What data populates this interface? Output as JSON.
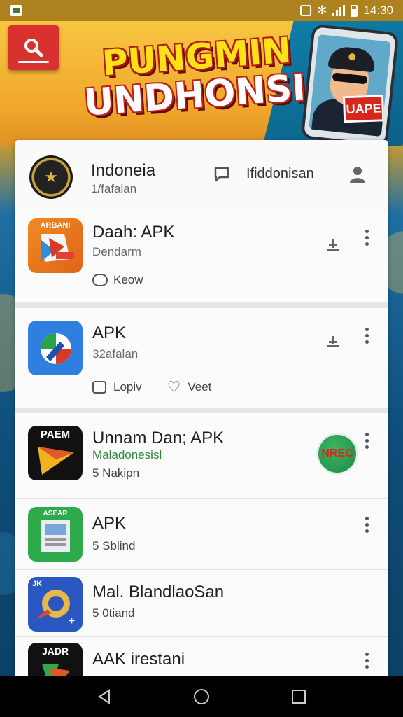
{
  "status_bar": {
    "time": "14:30"
  },
  "banner": {
    "title_line1": "PUNGMIN",
    "title_line2": "UNDHONSIA!",
    "sticker_text": "UAPE"
  },
  "header": {
    "title": "Indoneia",
    "subtitle": "1/fafalan",
    "link_text": "Ifiddonisan"
  },
  "apps": [
    {
      "icon_label": "ARBANI",
      "name": "Daah: APK",
      "subtitle": "Dendarm",
      "meta1_icon": "infinity-icon",
      "meta1": "Keow"
    },
    {
      "icon_label": "",
      "name": "APK",
      "subtitle": "32afalan",
      "meta1_icon": "square-icon",
      "meta1": "Lopiv",
      "meta2_icon": "heart-icon",
      "meta2": "Veet"
    },
    {
      "icon_label": "PAEM",
      "name": "Unnam Dan; APK",
      "subtitle": "Maladonesisl",
      "meta1_icon": "circle-number-icon",
      "meta1": "5 Nakipn",
      "badge": "NREC"
    },
    {
      "icon_label": "ASEAR",
      "name": "APK",
      "meta1": "5 Sblind"
    },
    {
      "icon_label": "JK",
      "name": "Mal. BlandlaoSan",
      "meta1": "5 0tiand"
    },
    {
      "icon_label": "JADR",
      "name": "AAK irestani"
    }
  ],
  "colors": {
    "banner_yellow": "#f7c642",
    "search_red": "#d8312f",
    "badge_green": "#1f8a45",
    "nav_black": "#000000"
  }
}
